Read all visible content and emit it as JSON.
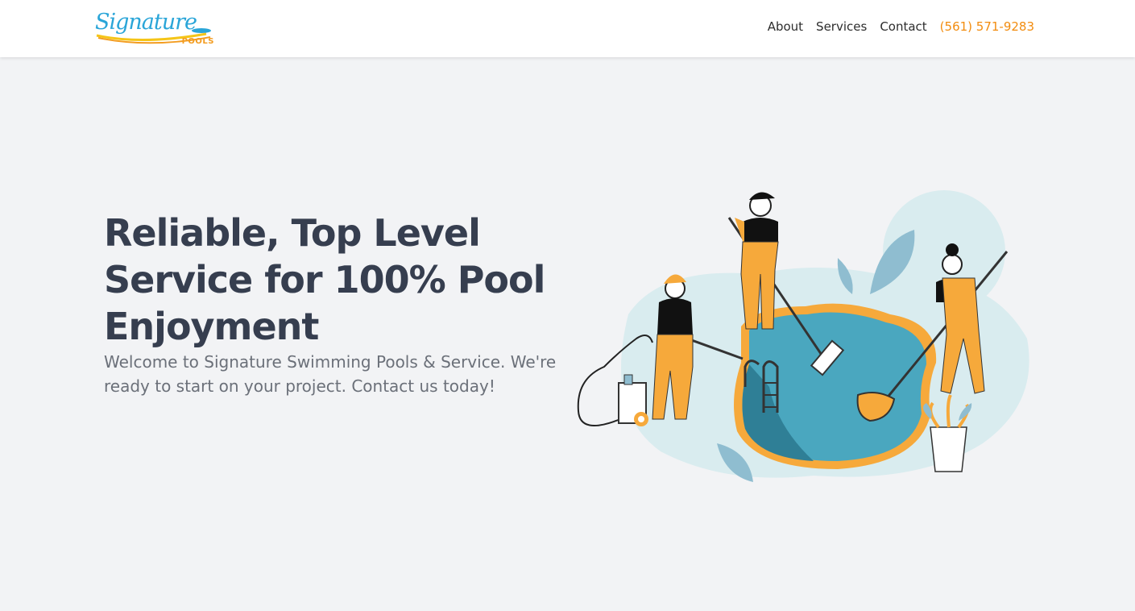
{
  "brand": {
    "script_text": "Signature",
    "sub_text": "POOLS"
  },
  "nav": {
    "items": [
      {
        "label": "About"
      },
      {
        "label": "Services"
      },
      {
        "label": "Contact"
      }
    ],
    "phone": "(561) 571-9283"
  },
  "hero": {
    "title": "Reliable, Top Level Service for 100% Pool Enjoyment",
    "subtitle": "Welcome to Signature Swimming Pools & Service. We're ready to start on your project. Contact us today!"
  },
  "colors": {
    "accent": "#f28c0f",
    "heading": "#363e4f",
    "pool": "#4aa7bf",
    "pool_rim": "#f6a93b",
    "bg": "#f2f3f5"
  },
  "illustration": {
    "icon": "pool-cleaning-workers-illustration"
  }
}
